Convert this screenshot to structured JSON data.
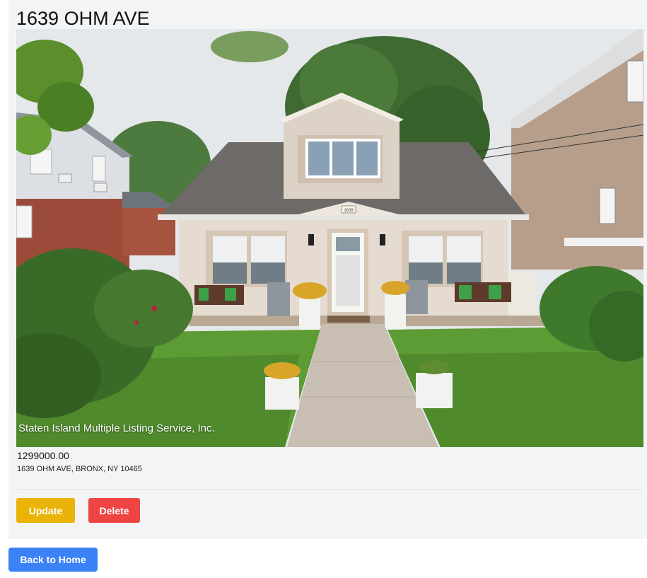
{
  "listing": {
    "title": "1639 OHM AVE",
    "price": "1299000.00",
    "address": "1639 OHM AVE, BRONX, NY 10465",
    "photo_watermark": "Staten Island Multiple Listing Service, Inc.",
    "house_number_plaque": "1639"
  },
  "actions": {
    "update_label": "Update",
    "delete_label": "Delete",
    "back_label": "Back to Home"
  },
  "colors": {
    "update": "#eab308",
    "delete": "#ef4444",
    "back": "#3b82f6",
    "card_bg": "#f3f4f6"
  }
}
